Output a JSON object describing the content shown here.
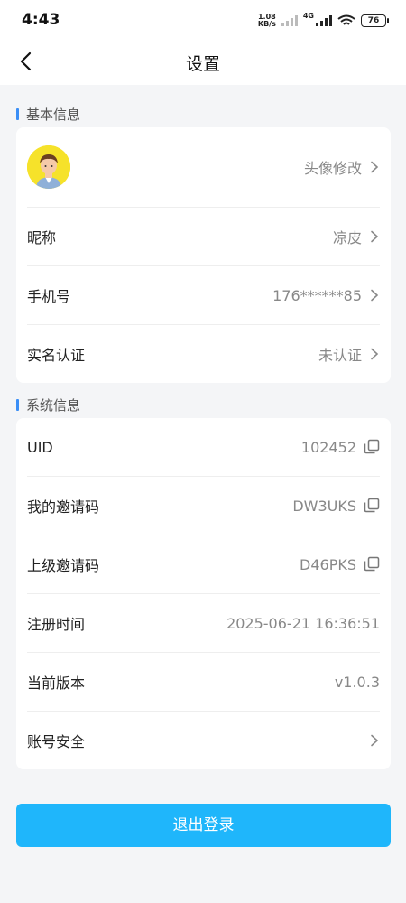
{
  "status_bar": {
    "time": "4:43",
    "net_speed_value": "1.08",
    "net_speed_unit": "KB/s",
    "signal_label": "4G",
    "battery": "76"
  },
  "header": {
    "title": "设置"
  },
  "basic_info": {
    "section_title": "基本信息",
    "avatar_action": "头像修改",
    "rows": [
      {
        "label": "昵称",
        "value": "凉皮"
      },
      {
        "label": "手机号",
        "value": "176******85"
      },
      {
        "label": "实名认证",
        "value": "未认证"
      }
    ]
  },
  "system_info": {
    "section_title": "系统信息",
    "rows": [
      {
        "label": "UID",
        "value": "102452"
      },
      {
        "label": "我的邀请码",
        "value": "DW3UKS"
      },
      {
        "label": "上级邀请码",
        "value": "D46PKS"
      },
      {
        "label": "注册时间",
        "value": "2025-06-21 16:36:51"
      },
      {
        "label": "当前版本",
        "value": "v1.0.3"
      },
      {
        "label": "账号安全",
        "value": ""
      }
    ]
  },
  "logout_label": "退出登录",
  "colors": {
    "accent": "#1fb6fb",
    "section_bar": "#3a8ef6",
    "background": "#f4f5f7"
  }
}
